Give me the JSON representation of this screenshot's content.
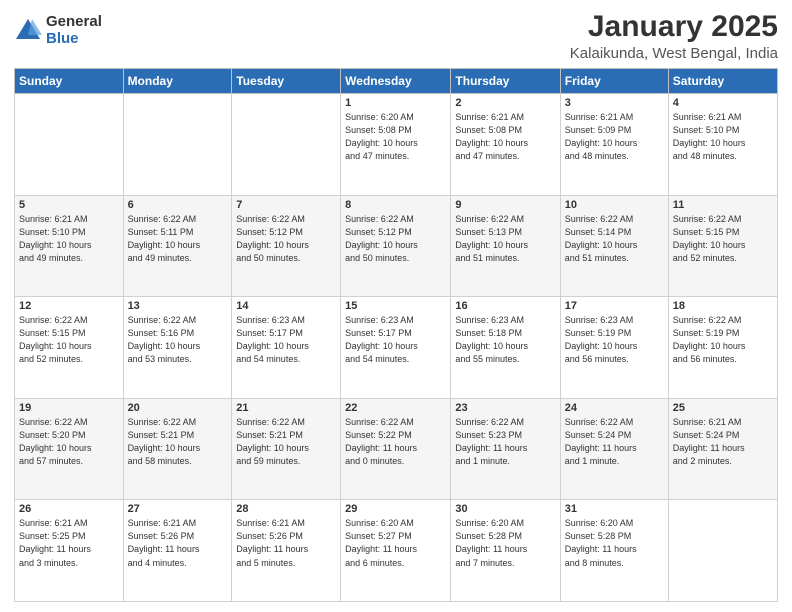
{
  "logo": {
    "general": "General",
    "blue": "Blue"
  },
  "header": {
    "title": "January 2025",
    "subtitle": "Kalaikunda, West Bengal, India"
  },
  "weekdays": [
    "Sunday",
    "Monday",
    "Tuesday",
    "Wednesday",
    "Thursday",
    "Friday",
    "Saturday"
  ],
  "weeks": [
    [
      {
        "day": "",
        "info": ""
      },
      {
        "day": "",
        "info": ""
      },
      {
        "day": "",
        "info": ""
      },
      {
        "day": "1",
        "info": "Sunrise: 6:20 AM\nSunset: 5:08 PM\nDaylight: 10 hours\nand 47 minutes."
      },
      {
        "day": "2",
        "info": "Sunrise: 6:21 AM\nSunset: 5:08 PM\nDaylight: 10 hours\nand 47 minutes."
      },
      {
        "day": "3",
        "info": "Sunrise: 6:21 AM\nSunset: 5:09 PM\nDaylight: 10 hours\nand 48 minutes."
      },
      {
        "day": "4",
        "info": "Sunrise: 6:21 AM\nSunset: 5:10 PM\nDaylight: 10 hours\nand 48 minutes."
      }
    ],
    [
      {
        "day": "5",
        "info": "Sunrise: 6:21 AM\nSunset: 5:10 PM\nDaylight: 10 hours\nand 49 minutes."
      },
      {
        "day": "6",
        "info": "Sunrise: 6:22 AM\nSunset: 5:11 PM\nDaylight: 10 hours\nand 49 minutes."
      },
      {
        "day": "7",
        "info": "Sunrise: 6:22 AM\nSunset: 5:12 PM\nDaylight: 10 hours\nand 50 minutes."
      },
      {
        "day": "8",
        "info": "Sunrise: 6:22 AM\nSunset: 5:12 PM\nDaylight: 10 hours\nand 50 minutes."
      },
      {
        "day": "9",
        "info": "Sunrise: 6:22 AM\nSunset: 5:13 PM\nDaylight: 10 hours\nand 51 minutes."
      },
      {
        "day": "10",
        "info": "Sunrise: 6:22 AM\nSunset: 5:14 PM\nDaylight: 10 hours\nand 51 minutes."
      },
      {
        "day": "11",
        "info": "Sunrise: 6:22 AM\nSunset: 5:15 PM\nDaylight: 10 hours\nand 52 minutes."
      }
    ],
    [
      {
        "day": "12",
        "info": "Sunrise: 6:22 AM\nSunset: 5:15 PM\nDaylight: 10 hours\nand 52 minutes."
      },
      {
        "day": "13",
        "info": "Sunrise: 6:22 AM\nSunset: 5:16 PM\nDaylight: 10 hours\nand 53 minutes."
      },
      {
        "day": "14",
        "info": "Sunrise: 6:23 AM\nSunset: 5:17 PM\nDaylight: 10 hours\nand 54 minutes."
      },
      {
        "day": "15",
        "info": "Sunrise: 6:23 AM\nSunset: 5:17 PM\nDaylight: 10 hours\nand 54 minutes."
      },
      {
        "day": "16",
        "info": "Sunrise: 6:23 AM\nSunset: 5:18 PM\nDaylight: 10 hours\nand 55 minutes."
      },
      {
        "day": "17",
        "info": "Sunrise: 6:23 AM\nSunset: 5:19 PM\nDaylight: 10 hours\nand 56 minutes."
      },
      {
        "day": "18",
        "info": "Sunrise: 6:22 AM\nSunset: 5:19 PM\nDaylight: 10 hours\nand 56 minutes."
      }
    ],
    [
      {
        "day": "19",
        "info": "Sunrise: 6:22 AM\nSunset: 5:20 PM\nDaylight: 10 hours\nand 57 minutes."
      },
      {
        "day": "20",
        "info": "Sunrise: 6:22 AM\nSunset: 5:21 PM\nDaylight: 10 hours\nand 58 minutes."
      },
      {
        "day": "21",
        "info": "Sunrise: 6:22 AM\nSunset: 5:21 PM\nDaylight: 10 hours\nand 59 minutes."
      },
      {
        "day": "22",
        "info": "Sunrise: 6:22 AM\nSunset: 5:22 PM\nDaylight: 11 hours\nand 0 minutes."
      },
      {
        "day": "23",
        "info": "Sunrise: 6:22 AM\nSunset: 5:23 PM\nDaylight: 11 hours\nand 1 minute."
      },
      {
        "day": "24",
        "info": "Sunrise: 6:22 AM\nSunset: 5:24 PM\nDaylight: 11 hours\nand 1 minute."
      },
      {
        "day": "25",
        "info": "Sunrise: 6:21 AM\nSunset: 5:24 PM\nDaylight: 11 hours\nand 2 minutes."
      }
    ],
    [
      {
        "day": "26",
        "info": "Sunrise: 6:21 AM\nSunset: 5:25 PM\nDaylight: 11 hours\nand 3 minutes."
      },
      {
        "day": "27",
        "info": "Sunrise: 6:21 AM\nSunset: 5:26 PM\nDaylight: 11 hours\nand 4 minutes."
      },
      {
        "day": "28",
        "info": "Sunrise: 6:21 AM\nSunset: 5:26 PM\nDaylight: 11 hours\nand 5 minutes."
      },
      {
        "day": "29",
        "info": "Sunrise: 6:20 AM\nSunset: 5:27 PM\nDaylight: 11 hours\nand 6 minutes."
      },
      {
        "day": "30",
        "info": "Sunrise: 6:20 AM\nSunset: 5:28 PM\nDaylight: 11 hours\nand 7 minutes."
      },
      {
        "day": "31",
        "info": "Sunrise: 6:20 AM\nSunset: 5:28 PM\nDaylight: 11 hours\nand 8 minutes."
      },
      {
        "day": "",
        "info": ""
      }
    ]
  ]
}
